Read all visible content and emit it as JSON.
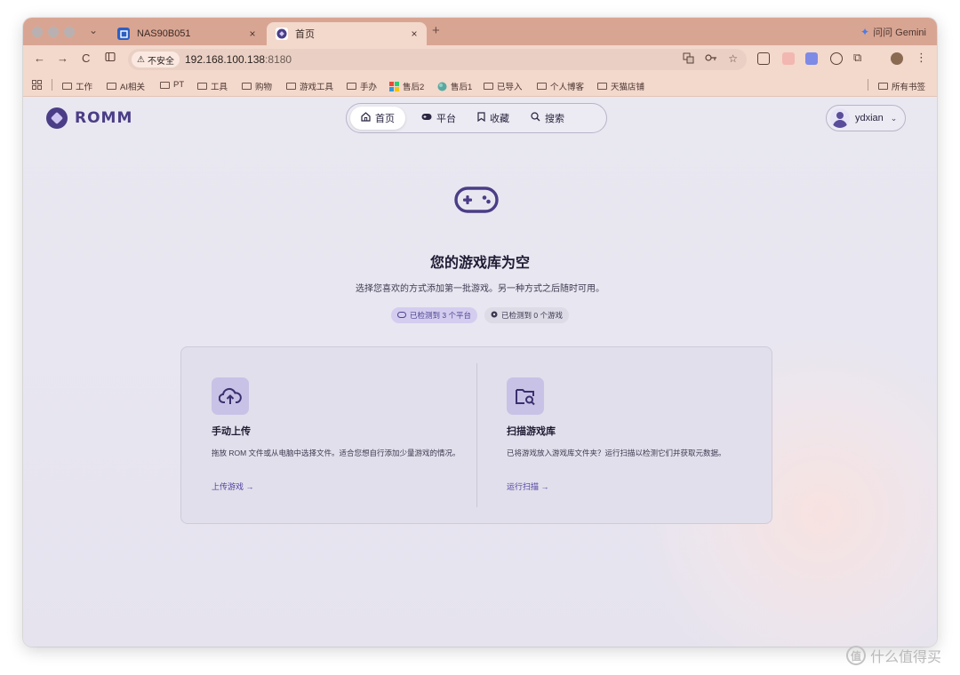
{
  "browser": {
    "tabs": [
      {
        "label": "NAS90B051",
        "close": "×"
      },
      {
        "label": "首页",
        "close": "×"
      }
    ],
    "new_tab": "+",
    "gemini": "问问 Gemini",
    "nav_back": "←",
    "nav_forward": "→",
    "nav_reload": "C",
    "security_label": "不安全",
    "url_host": "192.168.100.138",
    "url_port": ":8180",
    "bookmarks": [
      "工作",
      "AI相关",
      "PT",
      "工具",
      "购物",
      "游戏工具",
      "手办",
      "售后2",
      "售后1",
      "已导入",
      "个人博客",
      "天猫店铺"
    ],
    "all_bookmarks": "所有书签"
  },
  "app": {
    "logo_text": "ROMM",
    "nav": [
      {
        "icon": "⌂",
        "label": "首页"
      },
      {
        "icon": "🎮",
        "label": "平台"
      },
      {
        "icon": "⛉",
        "label": "收藏"
      },
      {
        "icon": "⌕",
        "label": "搜索"
      }
    ],
    "username": "ydxian",
    "empty_title": "您的游戏库为空",
    "empty_subtitle": "选择您喜欢的方式添加第一批游戏。另一种方式之后随时可用。",
    "chip_platforms": "已检测到 3 个平台",
    "chip_games": "已检测到 0 个游戏",
    "card_upload": {
      "title": "手动上传",
      "desc": "拖放 ROM 文件或从电脑中选择文件。适合您想自行添加少量游戏的情况。",
      "link": "上传游戏 →"
    },
    "card_scan": {
      "title": "扫描游戏库",
      "desc": "已将游戏放入游戏库文件夹？运行扫描以检测它们并获取元数据。",
      "link": "运行扫描 →"
    }
  },
  "watermark": {
    "badge": "值",
    "text": "什么值得买"
  },
  "colors": {
    "accent": "#4b3d86",
    "tabbar": "#d9a593",
    "toolbar": "#f3d8cc",
    "page_bg": "#e9e8f1"
  }
}
